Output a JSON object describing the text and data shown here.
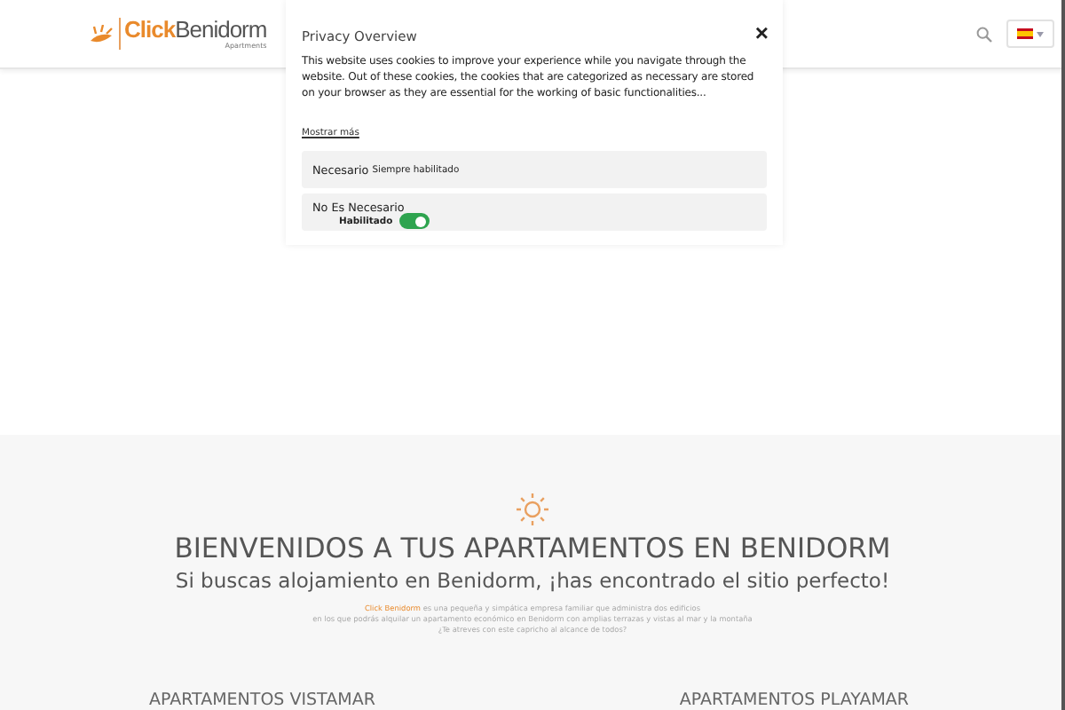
{
  "header": {
    "logo": {
      "brand_first": "Click",
      "brand_second": "Benidorm",
      "tagline": "Apartments"
    },
    "language": {
      "selected": true
    }
  },
  "cookie_dialog": {
    "title": "Privacy Overview",
    "close": "×",
    "body": "This website uses cookies to improve your experience while you navigate through the website. Out of these cookies, the cookies that are categorized as necessary are stored on your browser as they are essential for the working of basic functionalities...",
    "show_more": "Mostrar más",
    "categories": [
      {
        "kind": "fixed",
        "name": "Necesario",
        "status": "Siempre habilitado"
      },
      {
        "kind": "toggle",
        "name": "No Es Necesario",
        "status": "Habilitado",
        "on": true
      }
    ]
  },
  "welcome": {
    "title": "BIENVENIDOS A TUS APARTAMENTOS EN BENIDORM",
    "subtitle": "Si buscas alojamiento en Benidorm, ¡has encontrado el sitio perfecto!",
    "lines": [
      {
        "highlight": "Click Benidorm",
        "text": " es una pequeña y simpática empresa familiar que administra dos edificios"
      },
      {
        "text": "en los que podrás alquilar un apartamento económico en Benidorm con amplias terrazas y vistas al mar y la montaña"
      },
      {
        "text": "¿Te atreves con este capricho al alcance de todos?"
      }
    ]
  },
  "sections": [
    "APARTAMENTOS VISTAMAR",
    "APARTAMENTOS PLAYAMAR"
  ]
}
